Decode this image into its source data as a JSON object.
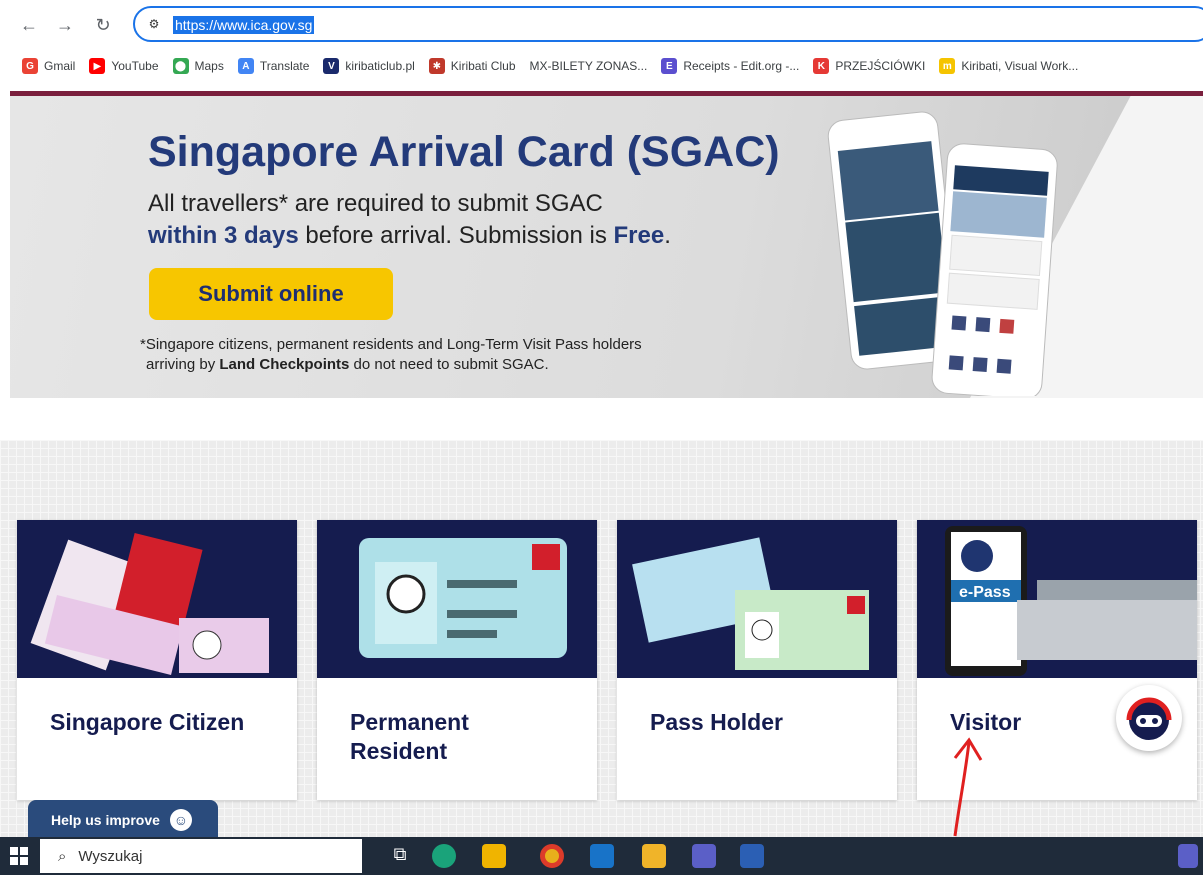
{
  "browser": {
    "url": "https://www.ica.gov.sg",
    "bookmarks": [
      {
        "label": "Gmail",
        "icon": "gmail-icon",
        "color": "#ea4335",
        "glyph": "G"
      },
      {
        "label": "YouTube",
        "icon": "youtube-icon",
        "color": "#ff0000",
        "glyph": "▶"
      },
      {
        "label": "Maps",
        "icon": "maps-icon",
        "color": "#34a853",
        "glyph": "⬤"
      },
      {
        "label": "Translate",
        "icon": "translate-icon",
        "color": "#4285f4",
        "glyph": "A"
      },
      {
        "label": "kiribaticlub.pl",
        "icon": "v-logo-icon",
        "color": "#1a2a6c",
        "glyph": "V"
      },
      {
        "label": "Kiribati Club",
        "icon": "kiribati-club-icon",
        "color": "#c0392b",
        "glyph": "✱"
      },
      {
        "label": "MX-BILETY ZONAS...",
        "icon": "",
        "color": "",
        "glyph": ""
      },
      {
        "label": "Receipts - Edit.org -...",
        "icon": "edit-org-icon",
        "color": "#5b4fcf",
        "glyph": "E"
      },
      {
        "label": "PRZEJŚCIÓWKI",
        "icon": "k-logo-icon",
        "color": "#e53935",
        "glyph": "K"
      },
      {
        "label": "Kiribati, Visual Work...",
        "icon": "miro-icon",
        "color": "#f5c400",
        "glyph": "m"
      }
    ]
  },
  "banner": {
    "title": "Singapore Arrival Card (SGAC)",
    "line1": "All travellers* are required to submit SGAC",
    "line2_bold": "within 3 days",
    "line2_rest": " before arrival. Submission is ",
    "line2_bold2": "Free",
    "line2_end": ".",
    "submit_label": "Submit online",
    "footnote1": "*Singapore citizens, permanent residents and Long-Term Visit Pass holders",
    "footnote2_pre": "arriving by ",
    "footnote2_bold": "Land Checkpoints",
    "footnote2_post": " do not need to submit SGAC."
  },
  "categories": [
    {
      "title": "Singapore Citizen"
    },
    {
      "title": "Permanent Resident"
    },
    {
      "title": "Pass Holder"
    },
    {
      "title": "Visitor"
    }
  ],
  "help_label": "Help us improve",
  "taskbar": {
    "search_placeholder": "Wyszukaj"
  },
  "colors": {
    "brand_navy": "#151c4f",
    "banner_title": "#233a7a",
    "cta_yellow": "#f7c600",
    "maroon_rule": "#7a1f3d",
    "annotation_arrow": "#e02020"
  }
}
